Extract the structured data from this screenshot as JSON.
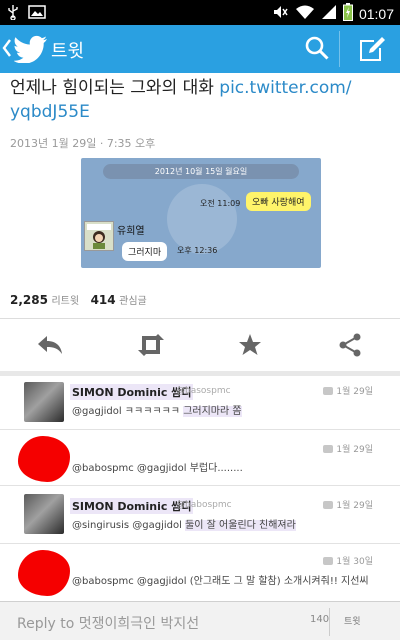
{
  "status_bar": {
    "time": "01:07"
  },
  "app_bar": {
    "title": "트윗",
    "accent": "#2aa0e1"
  },
  "tweet": {
    "text_main": "언제나 힘이되는 그와의 대화 ",
    "link_part1": "pic.twitter.com/",
    "link_part2": "yqbdJ55E",
    "timestamp": "2013년 1월 29일 · 7:35 오후",
    "picture": {
      "date_pill": "2012년 10월 15일 월요일",
      "time1": "오전 11:09",
      "bubble1": "오빠 사랑해여",
      "nickname": "유희열",
      "bubble2": "그러지마",
      "time2": "오후 12:36"
    },
    "retweet_count": "2,285",
    "retweet_label": "리트윗",
    "fav_count": "414",
    "fav_label": "관심글"
  },
  "replies": [
    {
      "name": "SIMON Dominic 쌈디",
      "handle": "@basospmc",
      "date": "1월 29일",
      "body_plain": "@gagjidol ㅋㅋㅋㅋㅋㅋ ",
      "body_highlight": "그러지마라 쫌",
      "avatar": "photo"
    },
    {
      "name": "",
      "handle": "",
      "date": "1월 29일",
      "body_plain": "@babospmc @gagjidol 부럽다........",
      "body_highlight": "",
      "avatar": "redacted"
    },
    {
      "name": "SIMON Dominic 쌈디",
      "handle": "@babospmc",
      "date": "1월 29일",
      "body_plain": "@singirusis @gagjidol ",
      "body_highlight": "둘이 잘 어울린다 친해져라",
      "avatar": "photo"
    },
    {
      "name": "",
      "handle": "",
      "date": "1월 30일",
      "body_plain": "@babospmc @gagjidol (안그래도 그 말 할참) 소개시켜줘!! 지선씨",
      "body_highlight": "",
      "avatar": "redacted"
    }
  ],
  "reply_bar": {
    "placeholder": "Reply to 멋쟁이희극인 박지선",
    "char_count": "140",
    "send_label": "트윗"
  },
  "icons": [
    "usb-icon",
    "image-icon",
    "silent-icon",
    "wifi-icon",
    "signal-icon",
    "battery-icon",
    "back-chevron-icon",
    "twitter-bird-icon",
    "search-icon",
    "compose-icon",
    "reply-icon",
    "retweet-icon",
    "favorite-star-icon",
    "share-icon",
    "reply-bubble-icon"
  ]
}
